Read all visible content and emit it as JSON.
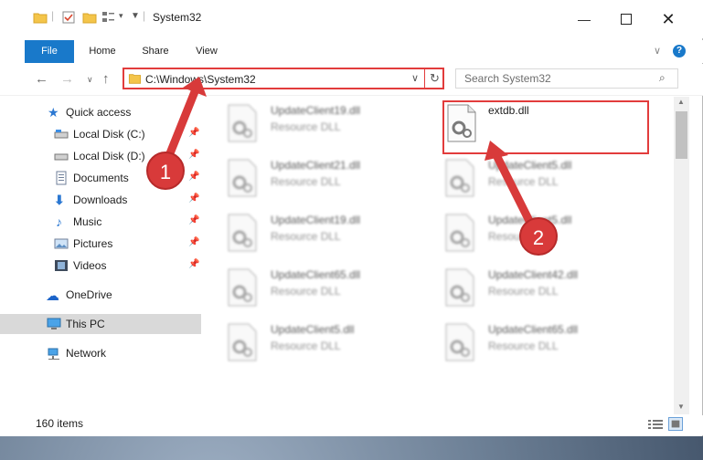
{
  "window": {
    "title": "System32",
    "tabs": [
      {
        "label": "File"
      },
      {
        "label": "Home"
      },
      {
        "label": "Share"
      },
      {
        "label": "View"
      }
    ]
  },
  "address": {
    "path": "C:\\Windows\\System32",
    "search_placeholder": "Search System32"
  },
  "nav": {
    "items": [
      {
        "label": "Quick access",
        "icon": "star-icon"
      },
      {
        "label": "Local Disk (C:)",
        "icon": "drive-icon"
      },
      {
        "label": "Local Disk (D:)",
        "icon": "drive-icon"
      },
      {
        "label": "Documents",
        "icon": "documents-icon"
      },
      {
        "label": "Downloads",
        "icon": "download-icon"
      },
      {
        "label": "Music",
        "icon": "music-icon"
      },
      {
        "label": "Pictures",
        "icon": "pictures-icon"
      },
      {
        "label": "Videos",
        "icon": "videos-icon"
      },
      {
        "label": "OneDrive",
        "icon": "cloud-icon"
      },
      {
        "label": "This PC",
        "icon": "computer-icon"
      },
      {
        "label": "Network",
        "icon": "network-icon"
      }
    ]
  },
  "files": [
    {
      "name": "UpdateClient19.dll",
      "type": "Resource DLL"
    },
    {
      "name": "extdb.dll",
      "type": ""
    },
    {
      "name": "UpdateClient21.dll",
      "type": "Resource DLL"
    },
    {
      "name": "UpdateClient5.dll",
      "type": "Resource DLL"
    },
    {
      "name": "UpdateClient19.dll",
      "type": "Resource DLL"
    },
    {
      "name": "UpdateClient5.dll",
      "type": "Resource DLL"
    },
    {
      "name": "UpdateClient65.dll",
      "type": "Resource DLL"
    },
    {
      "name": "UpdateClient42.dll",
      "type": "Resource DLL"
    },
    {
      "name": "UpdateClient5.dll",
      "type": "Resource DLL"
    },
    {
      "name": "UpdateClient65.dll",
      "type": "Resource DLL"
    }
  ],
  "status": {
    "item_count": "160 items"
  },
  "annotations": {
    "step1": "1",
    "step2": "2"
  },
  "colors": {
    "accent": "#1979ca",
    "highlight": "#e23c3c"
  }
}
